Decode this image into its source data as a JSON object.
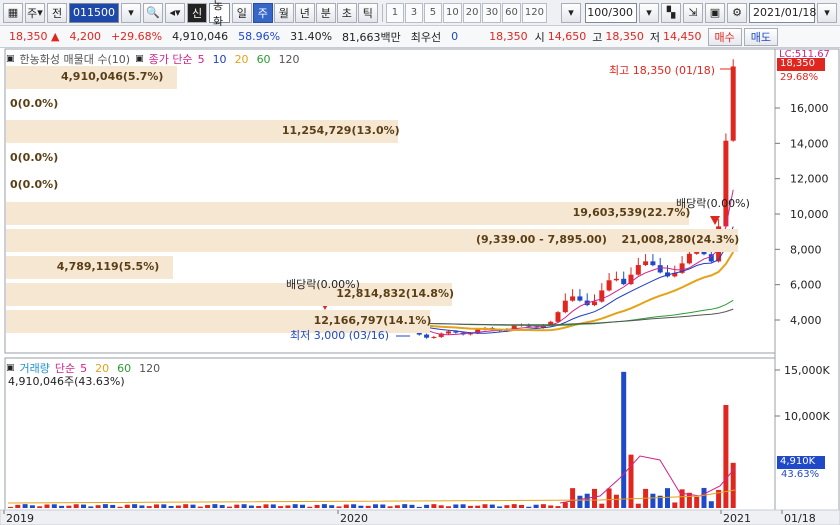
{
  "toolbar": {
    "market": "주",
    "prev": "전",
    "code": "011500",
    "name": "한농화성",
    "periods": [
      "일",
      "주",
      "월",
      "년",
      "분",
      "초",
      "틱"
    ],
    "active_period": "주",
    "multipliers": [
      "1",
      "3",
      "5",
      "10",
      "20",
      "30",
      "60",
      "120"
    ],
    "count": "100/300",
    "date": "2021/01/18"
  },
  "info": {
    "price": "18,350",
    "change": "4,200",
    "change_pct": "+29.68%",
    "volume": "4,910,046",
    "ratio1": "58.96%",
    "ratio2": "31.40%",
    "amount": "81,663백만",
    "preferred_label": "최우선",
    "preferred_value": "0",
    "ask_price": "18,350",
    "open_label": "시",
    "open": "14,650",
    "high_label": "고",
    "high": "18,350",
    "low_label": "저",
    "low": "14,450",
    "buy": "매수",
    "sell": "매도"
  },
  "price_panel": {
    "legend_name": "한농화성 매물대 수(10)",
    "ma_label": "종가 단순",
    "ma_periods": [
      "5",
      "10",
      "20",
      "60",
      "120"
    ],
    "ma_colors": [
      "#d0248a",
      "#1f3fbf",
      "#e3a318",
      "#2e9a35",
      "#555555"
    ],
    "lc_label": "LC:511.67",
    "last_price": "18,350",
    "last_pct": "29.68%",
    "high_note": "최고 18,350 (01/18)",
    "low_note": "최저 3,000 (03/16)",
    "dividend_1": "배당락(0.00%)",
    "dividend_2": "배당락(0.00%)",
    "y_ticks": [
      "16,000",
      "14,000",
      "12,000",
      "10,000",
      "8,000",
      "6,000",
      "4,000"
    ],
    "volume_profile": [
      {
        "label": "4,910,046(5.7%)",
        "value": 4910046
      },
      {
        "label": "0(0.0%)",
        "value": 0
      },
      {
        "label": "11,254,729(13.0%)",
        "value": 11254729
      },
      {
        "label": "0(0.0%)",
        "value": 0
      },
      {
        "label": "0(0.0%)",
        "value": 0
      },
      {
        "label": "19,603,539(22.7%)",
        "value": 19603539
      },
      {
        "label": "21,008,280(24.3%)",
        "value": 21008280
      },
      {
        "label": "4,789,119(5.5%)",
        "value": 4789119
      },
      {
        "label": "12,814,832(14.8%)",
        "value": 12814832
      },
      {
        "label": "12,166,797(14.1%)",
        "value": 12166797
      }
    ],
    "ma_price_text": "(9,339.00 - 7,895.00)"
  },
  "volume_panel": {
    "legend_name": "거래량",
    "ma_label": "단순",
    "ma_periods": [
      "5",
      "20",
      "60",
      "120"
    ],
    "current": "4,910,046주(43.63%)",
    "y_ticks": [
      "15,000K",
      "10,000K"
    ],
    "last_volume": "4,910K",
    "last_pct": "43.63%"
  },
  "x_axis": {
    "labels": [
      "2019",
      "2020",
      "2021",
      "01/18"
    ]
  }
}
